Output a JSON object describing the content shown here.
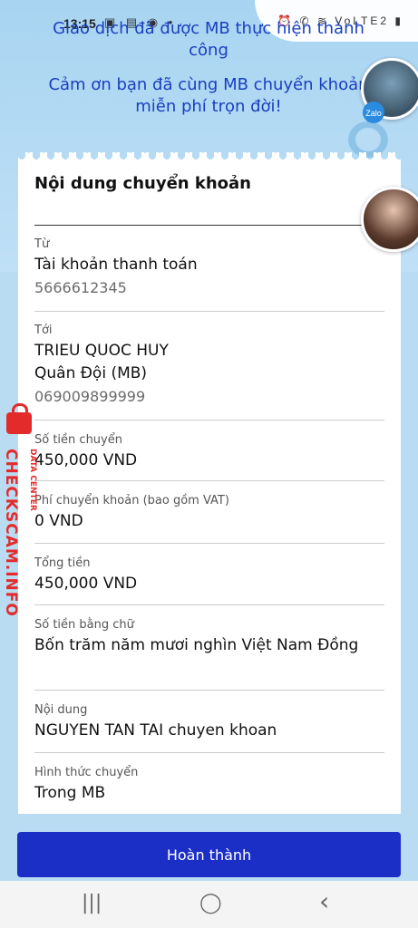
{
  "status_bar": {
    "time": "13:15",
    "icons_left": "▣ ▤ ◉ •",
    "icons_right": "⏰ ✆ ≋ VoLTE2 ▮"
  },
  "header": {
    "success_line": "Giao dịch đã được MB thực hiện thành công",
    "thanks_line": "Cảm ơn bạn đã cùng MB chuyển khoản miễn phí trọn đời!",
    "mascot_badge": "Zalo"
  },
  "card": {
    "title": "Nội dung chuyển khoản",
    "from": {
      "label": "Từ",
      "value": "Tài khoản thanh toán",
      "account": "5666612345"
    },
    "to": {
      "label": "Tới",
      "name": "TRIEU QUOC HUY",
      "bank": "Quân Đội (MB)",
      "account": "069009899999"
    },
    "amount": {
      "label": "Số tiền chuyển",
      "value": "450,000 VND"
    },
    "fee": {
      "label": "Phí chuyển khoản (bao gồm VAT)",
      "value": "0 VND"
    },
    "total": {
      "label": "Tổng tiền",
      "value": "450,000 VND"
    },
    "amount_words": {
      "label": "Số tiền bằng chữ",
      "value": "Bốn trăm năm mươi nghìn Việt Nam Đồng"
    },
    "content": {
      "label": "Nội dung",
      "value": "NGUYEN TAN TAI chuyen khoan"
    },
    "method": {
      "label": "Hình thức chuyển",
      "value": "Trong MB"
    }
  },
  "done_button": "Hoàn thành",
  "watermark": {
    "main": "CHECKSCAM.INFO",
    "sub": "DATA CENTER"
  },
  "nav": {
    "recent": "|||",
    "home": "◯",
    "back": "‹"
  },
  "colors": {
    "primary": "#1b2fc6",
    "headline": "#1a3fbf",
    "watermark": "#e32b2b"
  }
}
